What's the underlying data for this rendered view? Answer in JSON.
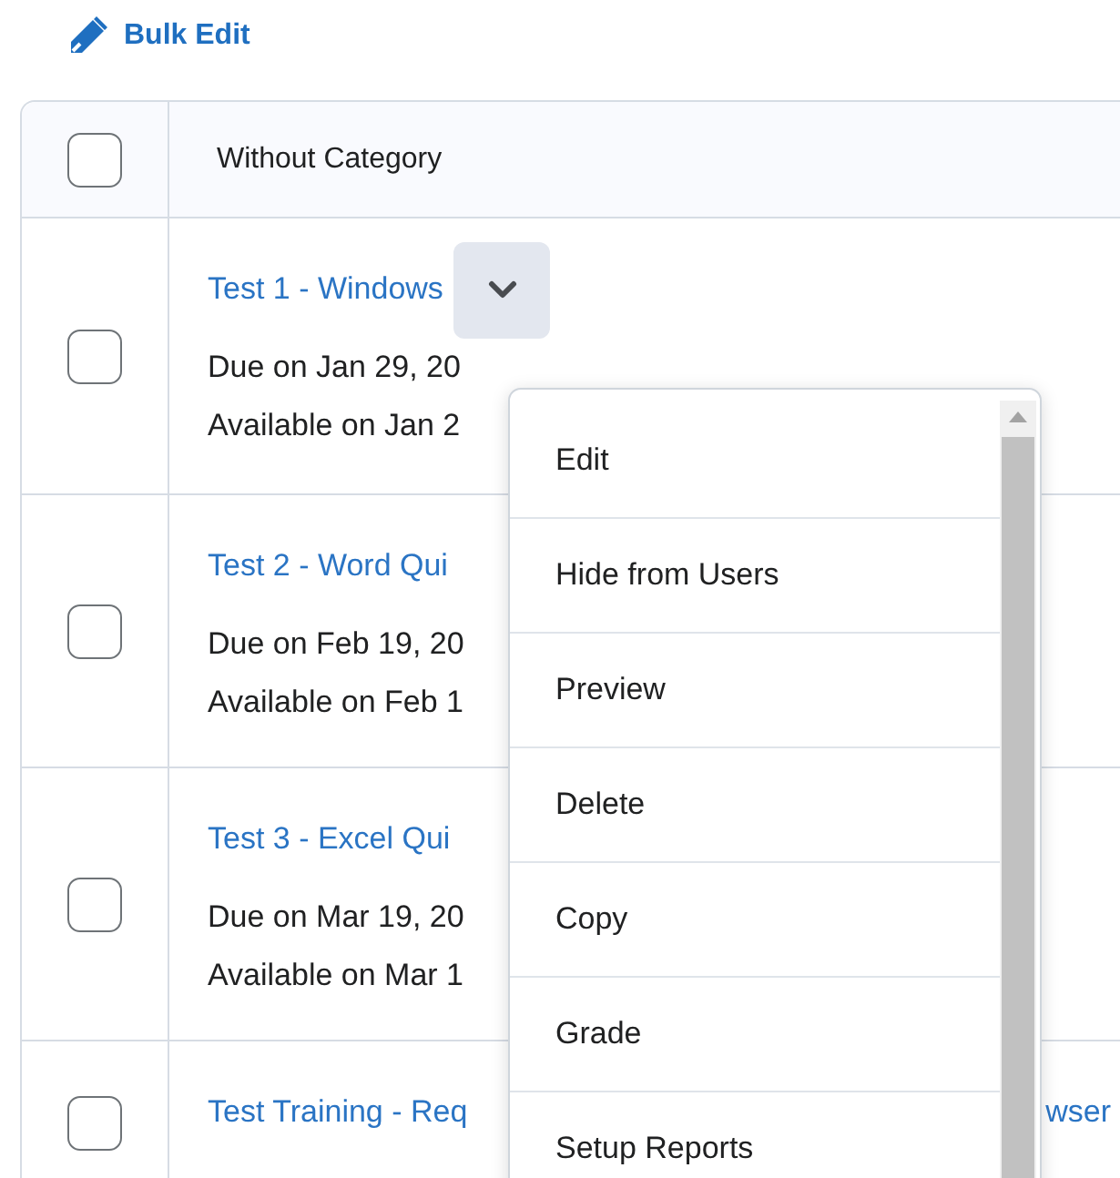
{
  "bulk_edit": {
    "label": "Bulk Edit"
  },
  "table": {
    "header": {
      "label": "Without Category",
      "checked": false
    },
    "rows": [
      {
        "title": "Test 1 - Windows",
        "title_tail": "",
        "checked": false,
        "menu_open": true,
        "due": "Due on Jan 29, 20",
        "available": "Available on Jan 2"
      },
      {
        "title": "Test 2 - Word Qui",
        "title_tail": "",
        "checked": false,
        "menu_open": false,
        "due": "Due on Feb 19, 20",
        "available": "Available on Feb 1"
      },
      {
        "title": "Test 3 - Excel Qui",
        "title_tail": "",
        "checked": false,
        "menu_open": false,
        "due": "Due on Mar 19, 20",
        "available": "Available on Mar 1"
      },
      {
        "title": "Test Training - Req",
        "title_tail": "wser",
        "checked": false,
        "menu_open": false,
        "due": "",
        "available": ""
      }
    ]
  },
  "menu": {
    "items": [
      "Edit",
      "Hide from Users",
      "Preview",
      "Delete",
      "Copy",
      "Grade",
      "Setup Reports"
    ]
  }
}
